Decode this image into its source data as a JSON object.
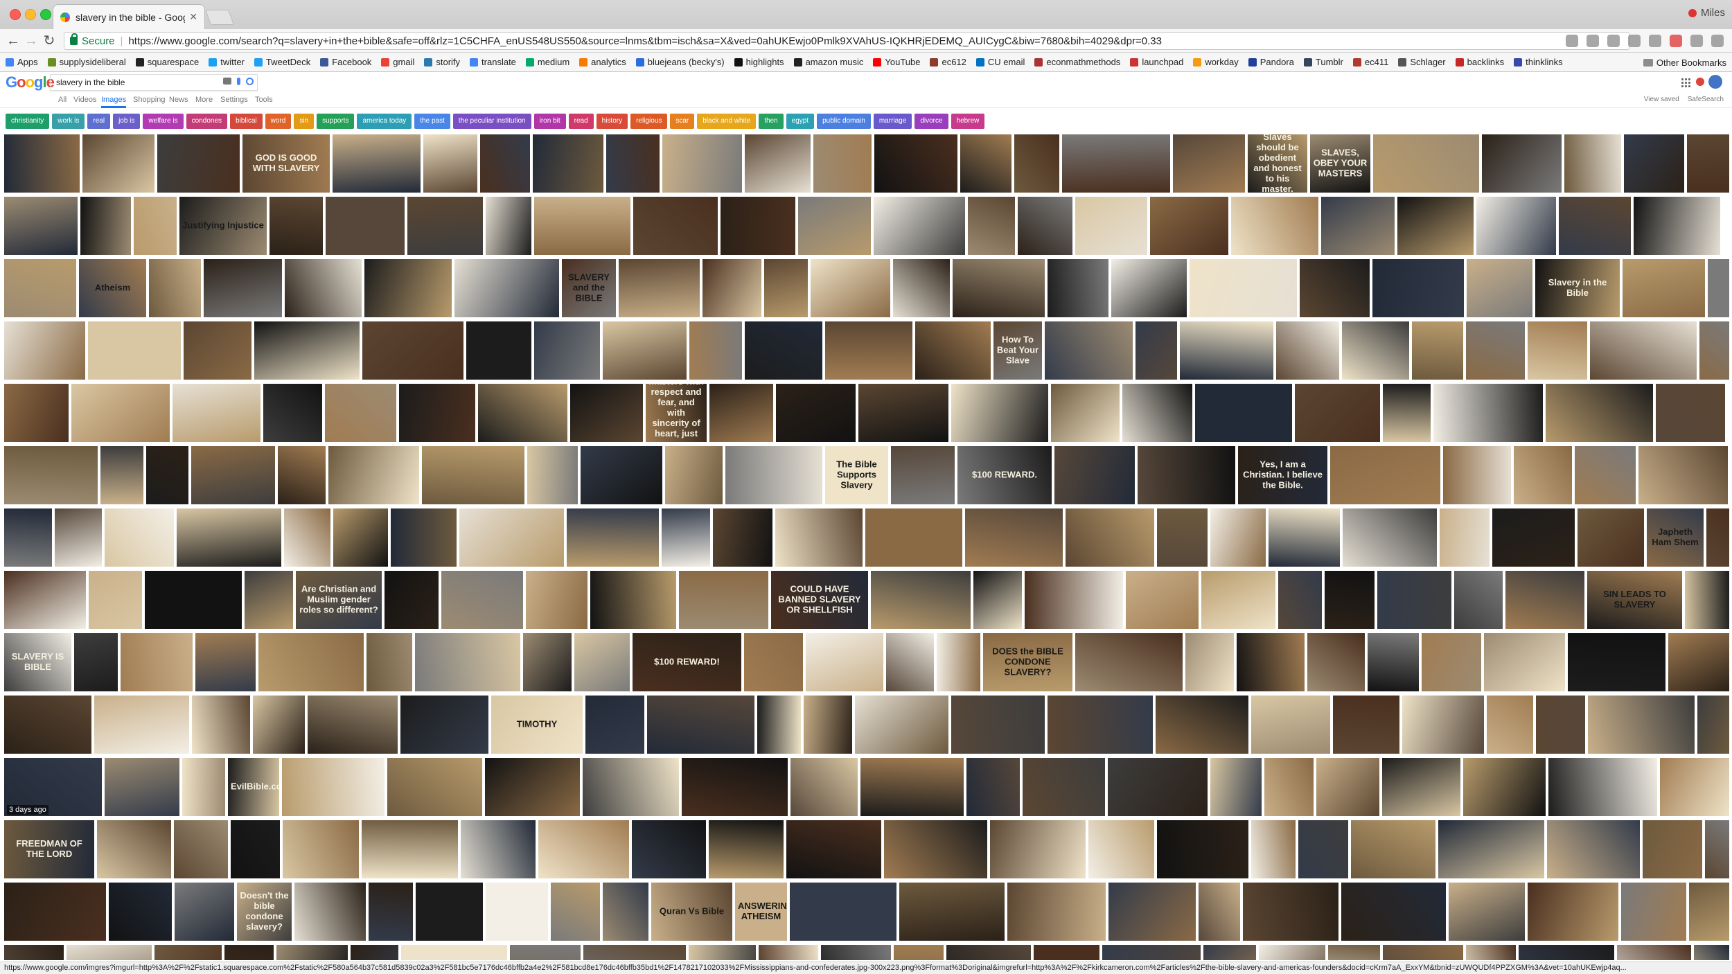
{
  "tab": {
    "title": "slavery in the bible - Google S"
  },
  "profile": {
    "name": "Miles"
  },
  "address": {
    "secure_label": "Secure",
    "url": "https://www.google.com/search?q=slavery+in+the+bible&safe=off&rlz=1C5CHFA_enUS548US550&source=lnms&tbm=isch&sa=X&ved=0ahUKEwjo0Pmlk9XVAhUS-IQKHRjEDEMQ_AUICygC&biw=7680&bih=4029&dpr=0.33"
  },
  "bookmarks": {
    "items": [
      {
        "label": "Apps",
        "color": "#4285f4"
      },
      {
        "label": "supplysideliberal",
        "color": "#6b8e23"
      },
      {
        "label": "squarespace",
        "color": "#222222"
      },
      {
        "label": "twitter",
        "color": "#1da1f2"
      },
      {
        "label": "TweetDeck",
        "color": "#1da1f2"
      },
      {
        "label": "Facebook",
        "color": "#3b5998"
      },
      {
        "label": "gmail",
        "color": "#ea4335"
      },
      {
        "label": "storify",
        "color": "#2a7ab0"
      },
      {
        "label": "translate",
        "color": "#4285f4"
      },
      {
        "label": "medium",
        "color": "#00ab6c"
      },
      {
        "label": "analytics",
        "color": "#f57c00"
      },
      {
        "label": "bluejeans (becky's)",
        "color": "#2d6cdf"
      },
      {
        "label": "highlights",
        "color": "#111111"
      },
      {
        "label": "amazon music",
        "color": "#222222"
      },
      {
        "label": "YouTube",
        "color": "#ff0000"
      },
      {
        "label": "ec612",
        "color": "#8e3b2b"
      },
      {
        "label": "CU email",
        "color": "#0072c6"
      },
      {
        "label": "econmathmethods",
        "color": "#a33"
      },
      {
        "label": "launchpad",
        "color": "#cc3333"
      },
      {
        "label": "workday",
        "color": "#f39c12"
      },
      {
        "label": "Pandora",
        "color": "#224099"
      },
      {
        "label": "Tumblr",
        "color": "#35465c"
      },
      {
        "label": "ec411",
        "color": "#b03a2e"
      },
      {
        "label": "Schlager",
        "color": "#555555"
      },
      {
        "label": "backlinks",
        "color": "#c62828"
      },
      {
        "label": "thinklinks",
        "color": "#3949ab"
      }
    ],
    "other": "Other Bookmarks"
  },
  "google": {
    "logo": [
      "G",
      "o",
      "o",
      "g",
      "l",
      "e"
    ],
    "query": "slavery in the bible",
    "tabs": [
      {
        "label": "All",
        "active": false
      },
      {
        "label": "Videos",
        "active": false
      },
      {
        "label": "Images",
        "active": true
      },
      {
        "label": "Shopping",
        "active": false
      },
      {
        "label": "News",
        "active": false
      },
      {
        "label": "More",
        "active": false
      },
      {
        "label": "Settings",
        "active": false
      },
      {
        "label": "Tools",
        "active": false
      }
    ],
    "view_saved": "View saved",
    "safesearch": "SafeSearch"
  },
  "chips": [
    {
      "label": "christianity",
      "color": "#1e9e6b"
    },
    {
      "label": "work is",
      "color": "#37a0a8"
    },
    {
      "label": "real",
      "color": "#5d6fd1"
    },
    {
      "label": "job is",
      "color": "#6b5fc9"
    },
    {
      "label": "welfare is",
      "color": "#b23bb3"
    },
    {
      "label": "condones",
      "color": "#c43c77"
    },
    {
      "label": "biblical",
      "color": "#d4493c"
    },
    {
      "label": "word",
      "color": "#e0632a"
    },
    {
      "label": "sin",
      "color": "#e39b16"
    },
    {
      "label": "supports",
      "color": "#24a057"
    },
    {
      "label": "america today",
      "color": "#2c9fb6"
    },
    {
      "label": "the past",
      "color": "#4a86e8"
    },
    {
      "label": "the peculiar institution",
      "color": "#7a4fc4"
    },
    {
      "label": "iron bit",
      "color": "#b136a8"
    },
    {
      "label": "read",
      "color": "#d03a6a"
    },
    {
      "label": "history",
      "color": "#d94b38"
    },
    {
      "label": "religious",
      "color": "#dd5a26"
    },
    {
      "label": "scar",
      "color": "#e87f1d"
    },
    {
      "label": "black and white",
      "color": "#e8a61a"
    },
    {
      "label": "then",
      "color": "#27a15f"
    },
    {
      "label": "egypt",
      "color": "#2aa2b4"
    },
    {
      "label": "public domain",
      "color": "#4c80e0"
    },
    {
      "label": "marriage",
      "color": "#6a59cc"
    },
    {
      "label": "divorce",
      "color": "#9a3ebd"
    },
    {
      "label": "hebrew",
      "color": "#c83a8b"
    }
  ],
  "captions": [
    "GOD IS GOOD WITH SLAVERY",
    "Slaves should be obedient and honest to his master.",
    "SLAVES, OBEY YOUR MASTERS",
    "Justifying Injustice",
    "Atheism",
    "SLAVERY and the BIBLE",
    "Slavery in the Bible",
    "How To Beat Your Slave",
    "Slaves, obey your earthly masters with respect and fear, and with sincerity of heart, just as you would obey Christ.",
    "The Bible Supports Slavery",
    "$100 REWARD.",
    "Yes, I am a Christian. I believe the Bible.",
    "Are Christian and Muslim gender roles so different?",
    "SIN LEADS TO SLAVERY",
    "COULD HAVE BANNED SLAVERY OR SHELLFISH",
    "DOES the BIBLE CONDONE SLAVERY?",
    "$100 REWARD!",
    "SLAVERY IS BIBLE",
    "TIMOTHY",
    "EvilBible.com",
    "FREEDMAN OF THE LORD",
    "Doesn't the bible condone slavery?",
    "ANSWERING ATHEISM",
    "Quran Vs Bible",
    "Japheth Ham Shem"
  ],
  "time_badge": "3 days ago",
  "status": {
    "url": "https://www.google.com/imgres?imgurl=http%3A%2F%2Fstatic1.squarespace.com%2Fstatic%2F580a564b37c581d5839c02a3%2F581bc5e7176dc46bffb2a4e2%2F581bcd8e176dc46bffb35bd1%2F1478217102033%2FMississippians-and-confederates.jpg-300x223.png%3Fformat%3Doriginal&imgrefurl=http%3A%2F%2Fkirkcameron.com%2Farticles%2Fthe-bible-slavery-and-americas-founders&docid=cKrm7aA_ExxYM&tbnid=zUWQUDf4PPZXGM%3A&vet=10ahUKEwjp4aq..."
  }
}
